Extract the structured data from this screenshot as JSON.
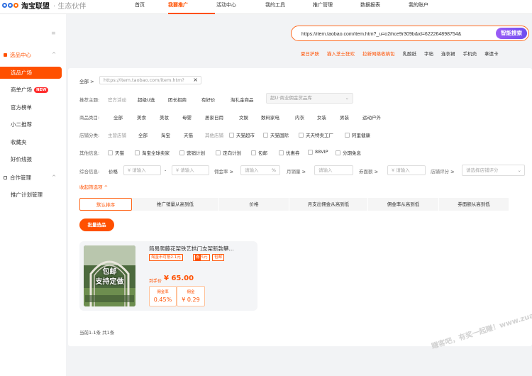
{
  "header": {
    "logo_text": "淘宝联盟",
    "logo_sub": "· 生态伙伴",
    "nav": [
      "首页",
      "我要推广",
      "活动中心",
      "我的工具",
      "推广管理",
      "数据报表",
      "我的账户"
    ]
  },
  "sidebar": {
    "collapse_icon": "≡",
    "groups": [
      {
        "label": "选品中心",
        "items": [
          "选品广场",
          "商单广场",
          "官方榜单",
          "小二推荐",
          "收藏夹",
          "好价线报"
        ]
      },
      {
        "label": "合作管理",
        "items": [
          "推广计划管理"
        ]
      }
    ],
    "new_badge": "NEW"
  },
  "search": {
    "value": "https://item.taobao.com/item.htm?_u=o2ihce9r309b&id=622264898754&",
    "button": "智能搜索"
  },
  "quick_links": [
    "夏日护肤",
    "猫入芝士狂欢",
    "拉新网络收纳包",
    "乳酸纸",
    "字帖",
    "连衣裙",
    "手机壳",
    "拿遗卡"
  ],
  "filters": {
    "breadcrumb_all": "全部 >",
    "url_pill": "https://item.taobao.com/item.htm?",
    "theme": {
      "label": "推荐主题:",
      "options": [
        "官方活动",
        "超级U选",
        "团长招商",
        "有好价",
        "淘礼金商品"
      ],
      "select": "超U·商业佣金货品库"
    },
    "category": {
      "label": "商品类目:",
      "options": [
        "全部",
        "美食",
        "美妆",
        "母婴",
        "居家日用",
        "文娱",
        "数码家电",
        "内衣",
        "女装",
        "男装",
        "运动户外"
      ]
    },
    "shop": {
      "label": "店铺分类:",
      "sub_label": "主营店铺",
      "options": [
        "全部",
        "淘宝",
        "天猫",
        "其他店铺"
      ],
      "checks": [
        "天猫超市",
        "天猫国际",
        "天天特卖工厂",
        "阿里健康"
      ]
    },
    "other": {
      "label": "其他信息:",
      "checks": [
        "天猫",
        "淘宝全球卖家",
        "营销计划",
        "定向计划",
        "包邮",
        "优惠券",
        "88VIP",
        "分期免息"
      ]
    },
    "info": {
      "label": "综合信息:",
      "price_label": "价格",
      "price_min": "¥ 请输入",
      "dash": "-",
      "price_max": "¥ 请输入",
      "commission_label": "佣金率 ≥",
      "commission": "请输入",
      "percent": "%",
      "sales_label": "月销量 ≥",
      "sales": "请输入",
      "coupon_label": "券面额 ≥",
      "coupon": "¥ 请输入",
      "shop_score_label": "店铺评分 ≥",
      "shop_score": "请选择店铺评分"
    },
    "collapse_link": "收起筛选项 ^"
  },
  "sort_tabs": [
    "默认排序",
    "推广销量从高到低",
    "价格",
    "月支出佣金从高到低",
    "佣金率从高到低",
    "券面额从高到低"
  ],
  "batch_button": "批量选品",
  "product": {
    "title": "简易爬藤花架铁艺拱门支架新款攀...",
    "image_text_1": "包邮",
    "image_text_2": "支持定做",
    "tags": [
      "淘金币可抵2.1元",
      "5元",
      "包邮"
    ],
    "price_label": "到手价",
    "price": "¥ 65.00",
    "commission_rate_label": "佣金率",
    "commission_rate": "0.45%",
    "commission_label": "佣金",
    "commission": "¥ 0.29"
  },
  "result_count": "当前1-1条 共1条",
  "watermark": "赚客吧，有奖一起赚！www.zuanke8.com",
  "colors": {
    "accent": "#ff5000",
    "ai_button": "#7b55f3",
    "logo": "#2f6fe0"
  }
}
